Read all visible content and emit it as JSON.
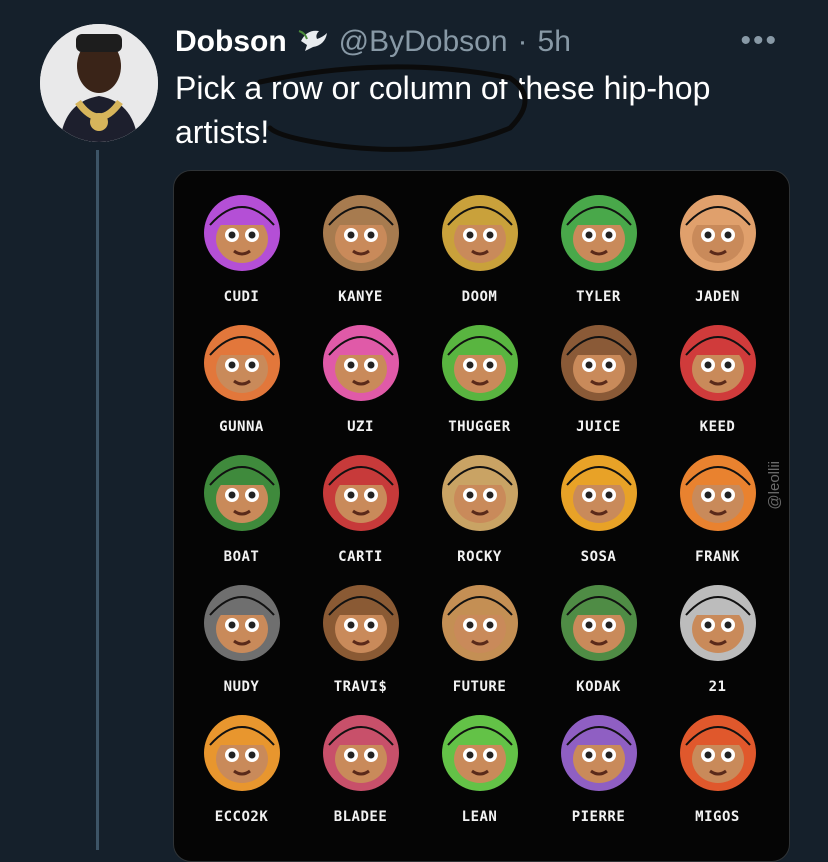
{
  "tweet": {
    "name": "Dobson",
    "handle": "@ByDobson",
    "separator": "·",
    "time": "5h",
    "more": "•••",
    "text": "Pick a row or column of these hip-hop artists!"
  },
  "image": {
    "watermark": "@leollii",
    "artists": [
      {
        "label": "CUDI",
        "color": "#b44fd6"
      },
      {
        "label": "KANYE",
        "color": "#a77b4f"
      },
      {
        "label": "DOOM",
        "color": "#c9a13b"
      },
      {
        "label": "TYLER",
        "color": "#49a84a"
      },
      {
        "label": "JADEN",
        "color": "#e0a06c"
      },
      {
        "label": "GUNNA",
        "color": "#e2773b"
      },
      {
        "label": "UZI",
        "color": "#e05aa8"
      },
      {
        "label": "THUGGER",
        "color": "#59b540"
      },
      {
        "label": "JUICE",
        "color": "#8a5a37"
      },
      {
        "label": "KEED",
        "color": "#d03b3b"
      },
      {
        "label": "BOAT",
        "color": "#3f8a3c"
      },
      {
        "label": "CARTI",
        "color": "#c73a3a"
      },
      {
        "label": "ROCKY",
        "color": "#c9a364"
      },
      {
        "label": "SOSA",
        "color": "#e8a227"
      },
      {
        "label": "FRANK",
        "color": "#e9822f"
      },
      {
        "label": "NUDY",
        "color": "#6f6f6f"
      },
      {
        "label": "TRAVI$",
        "color": "#8a5a34"
      },
      {
        "label": "FUTURE",
        "color": "#c48f54"
      },
      {
        "label": "KODAK",
        "color": "#4f8c45"
      },
      {
        "label": "21",
        "color": "#bcbcbc"
      },
      {
        "label": "ECCO2K",
        "color": "#e8962e"
      },
      {
        "label": "BLADEE",
        "color": "#c8506a"
      },
      {
        "label": "LEAN",
        "color": "#63c247"
      },
      {
        "label": "PIERRE",
        "color": "#8f5fc3"
      },
      {
        "label": "MIGOS",
        "color": "#e0582c"
      }
    ]
  }
}
